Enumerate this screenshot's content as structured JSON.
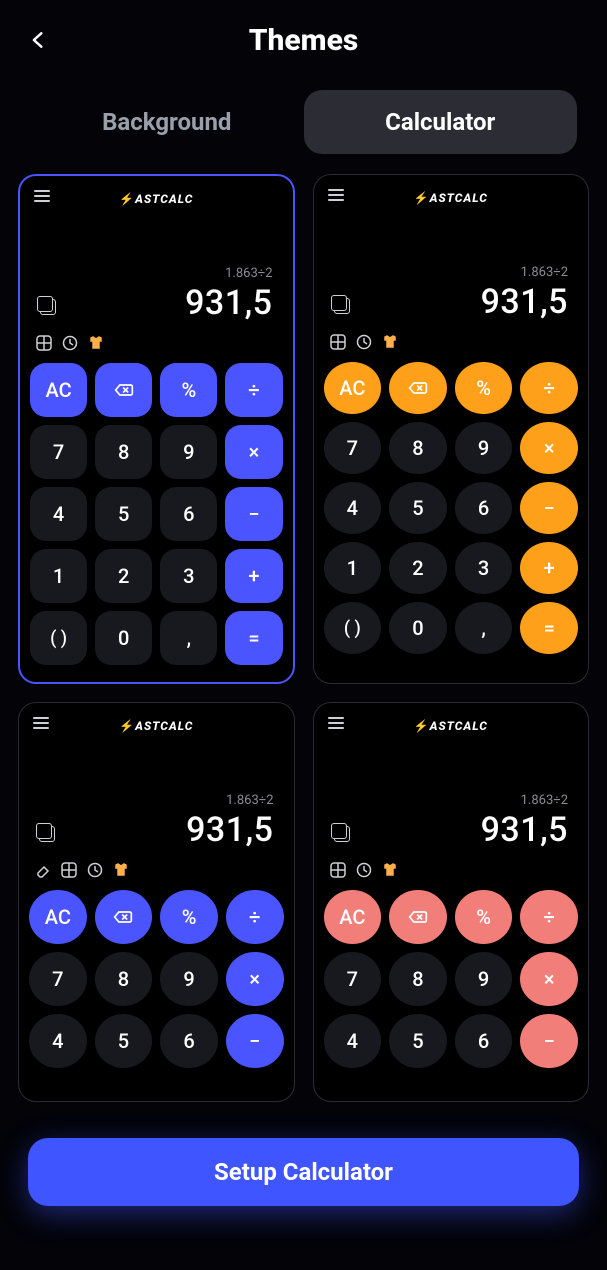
{
  "header": {
    "title": "Themes"
  },
  "tabs": {
    "background": "Background",
    "calculator": "Calculator",
    "active": "calculator"
  },
  "setup": {
    "label": "Setup Calculator"
  },
  "brand": {
    "pre": "",
    "text": "ASTCALC"
  },
  "display": {
    "expression": "1.863÷2",
    "result": "931,5"
  },
  "keys": {
    "ac": "AC",
    "percent": "%",
    "divide": "÷",
    "multiply": "×",
    "minus": "−",
    "plus": "+",
    "equals": "=",
    "seven": "7",
    "eight": "8",
    "nine": "9",
    "four": "4",
    "five": "5",
    "six": "6",
    "one": "1",
    "two": "2",
    "three": "3",
    "paren": "( )",
    "zero": "0",
    "comma": ","
  },
  "themes": [
    {
      "id": "blue-sq",
      "selected": true,
      "style": "square",
      "accent": "#4a54ff"
    },
    {
      "id": "orange",
      "selected": false,
      "style": "round",
      "accent": "#ffa01a"
    },
    {
      "id": "blue-rnd",
      "selected": false,
      "style": "round",
      "accent": "#4a54ff",
      "extraToolIcon": true
    },
    {
      "id": "coral",
      "selected": false,
      "style": "round",
      "accent": "#f17e78"
    }
  ]
}
